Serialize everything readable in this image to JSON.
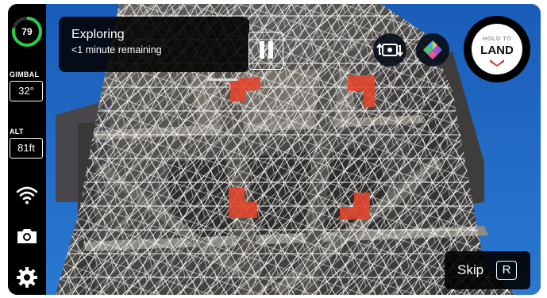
{
  "battery": {
    "percent": 79,
    "percent_label": "79",
    "color": "#2ecc40"
  },
  "gimbal": {
    "label": "GIMBAL",
    "value": "32°"
  },
  "altitude": {
    "label": "ALT",
    "value": "81ft"
  },
  "status": {
    "title": "Exploring",
    "subtitle": "<1 minute remaining"
  },
  "land": {
    "hold_label": "HOLD TO",
    "label": "LAND",
    "accent": "#d6362c"
  },
  "skip": {
    "label": "Skip",
    "key": "R"
  },
  "icons": {
    "battery": "battery-ring-icon",
    "wifi": "wifi-icon",
    "camera": "camera-icon",
    "settings": "gear-icon",
    "pause": "pause-icon",
    "switch_camera": "switch-camera-icon",
    "app": "app-logo-icon",
    "land_chevron": "chevron-down-icon"
  },
  "colors": {
    "sky": "#1d62b8",
    "markers": "#e0452c",
    "mesh": "#ffffff",
    "sidebar": "#000000"
  }
}
